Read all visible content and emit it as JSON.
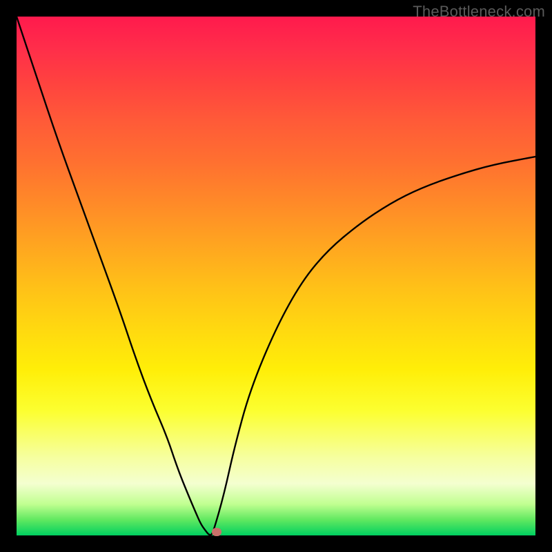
{
  "watermark": "TheBottleneck.com",
  "colors": {
    "curve": "#000000",
    "marker": "#c9706a",
    "frame_bg_top": "#ff1a4d",
    "frame_bg_bottom": "#00d060",
    "page_bg": "#000000"
  },
  "chart_data": {
    "type": "line",
    "title": "",
    "xlabel": "",
    "ylabel": "",
    "xlim": [
      0,
      100
    ],
    "ylim": [
      0,
      100
    ],
    "grid": false,
    "legend": false,
    "annotations": [
      "TheBottleneck.com"
    ],
    "series": [
      {
        "name": "bottleneck-curve",
        "x": [
          0,
          4,
          8,
          12,
          16,
          20,
          23,
          26,
          29,
          31,
          33,
          34.5,
          35.5,
          36.5,
          37,
          37.5,
          38,
          40,
          42,
          45,
          50,
          55,
          60,
          66,
          72,
          78,
          85,
          92,
          100
        ],
        "y": [
          100,
          88,
          76,
          65,
          54,
          43,
          34,
          26,
          19,
          13,
          8,
          4.5,
          2.2,
          0.8,
          0.2,
          0.0,
          1.0,
          8,
          17,
          28,
          40,
          49,
          55,
          60,
          64,
          67,
          69.5,
          71.5,
          73
        ]
      }
    ],
    "minimum_point": {
      "x": 37.5,
      "y": 0.0
    },
    "marker": {
      "x": 38.5,
      "y": 0.0
    }
  }
}
